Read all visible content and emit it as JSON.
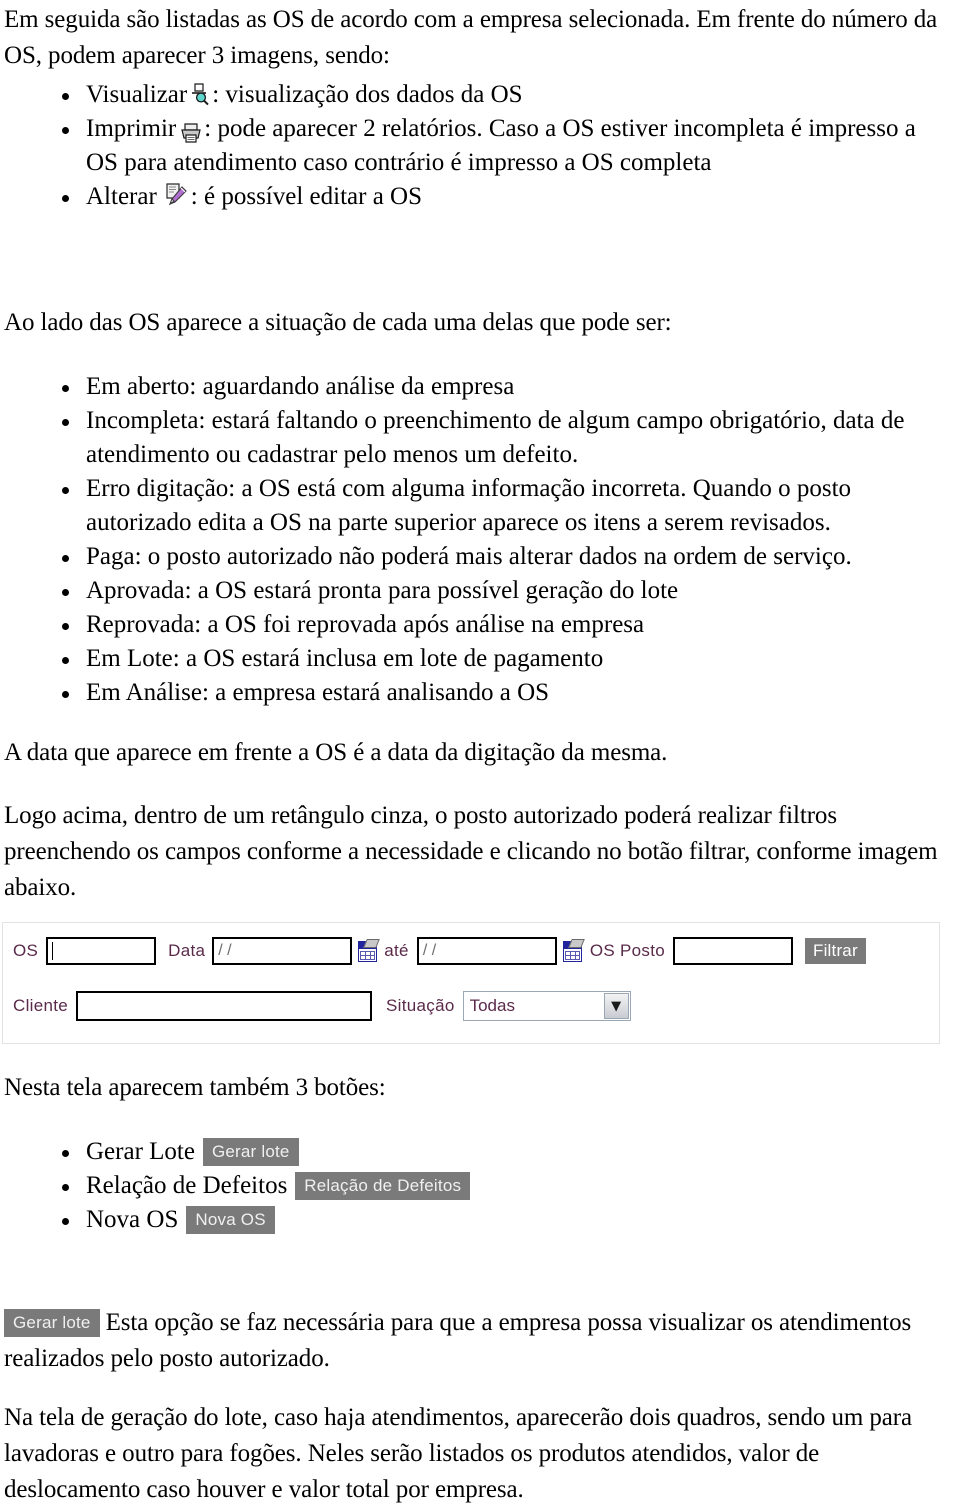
{
  "document": {
    "intro": "Em seguida são listadas as OS de acordo com a empresa selecionada. Em frente do número da OS, podem aparecer 3 imagens, sendo:",
    "icon_items": [
      {
        "prefix": "Visualizar",
        "icon": "magnifier-view-icon",
        "suffix": ": visualização dos dados da OS"
      },
      {
        "prefix": "Imprimir",
        "icon": "printer-icon",
        "suffix": ": pode aparecer 2 relatórios. Caso a OS estiver incompleta é impresso a OS para atendimento caso contrário é impresso a OS completa"
      },
      {
        "prefix": "Alterar",
        "icon": "edit-pencil-icon",
        "suffix": ": é possível editar a OS"
      }
    ],
    "situacao_intro": "Ao lado das OS aparece a situação de cada uma delas que pode ser:",
    "situacao_items": [
      "Em aberto: aguardando análise da empresa",
      "Incompleta: estará faltando o preenchimento de algum campo obrigatório, data de atendimento ou cadastrar pelo menos um defeito.",
      "Erro digitação: a OS está com alguma informação incorreta. Quando o posto autorizado edita a OS na parte superior aparece os itens a serem revisados.",
      "Paga: o posto autorizado não poderá mais alterar dados na ordem de serviço.",
      "Aprovada: a OS estará pronta para possível geração do lote",
      "Reprovada: a OS foi reprovada após análise na empresa",
      "Em Lote: a OS estará inclusa em lote de pagamento",
      "Em Análise: a empresa estará analisando a OS"
    ],
    "para_data": "A data que aparece em frente a OS é a data da digitação da mesma.",
    "para_logo": "Logo acima, dentro de um retângulo cinza, o posto autorizado poderá realizar filtros preenchendo os campos conforme a necessidade e clicando no botão filtrar, conforme imagem abaixo.",
    "para_3botoes": "Nesta tela aparecem também 3 botões:",
    "botoes_items": [
      {
        "text": "Gerar Lote",
        "button": "Gerar lote"
      },
      {
        "text": "Relação de Defeitos",
        "button": "Relação de Defeitos"
      },
      {
        "text": "Nova OS",
        "button": "Nova OS"
      }
    ],
    "para_gerarlote": {
      "button": "Gerar lote",
      "text": "Esta opção se faz necessária para que a empresa possa visualizar os atendimentos realizados pelo posto autorizado."
    },
    "para_final": "Na tela de geração do lote, caso haja atendimentos, aparecerão dois quadros, sendo um para lavadoras e outro para fogões. Neles serão listados os produtos atendidos, valor de deslocamento caso houver e valor total por empresa."
  },
  "filter_form": {
    "labels": {
      "os": "OS",
      "data": "Data",
      "ate": "até",
      "os_posto": "OS Posto",
      "cliente": "Cliente",
      "situacao": "Situação"
    },
    "values": {
      "os": "",
      "data": "/ /",
      "data_ate": "/ /",
      "os_posto": "",
      "cliente": "",
      "situacao_selected": "Todas"
    },
    "buttons": {
      "filtrar": "Filtrar"
    },
    "icons": {
      "calendar": "calendar-picker-icon",
      "dropdown": "chevron-down-icon"
    },
    "colors": {
      "label": "#5a2a4a",
      "button_bg": "#7a7a7a",
      "button_text": "#ffffff",
      "calendar_header": "#22249c"
    }
  }
}
